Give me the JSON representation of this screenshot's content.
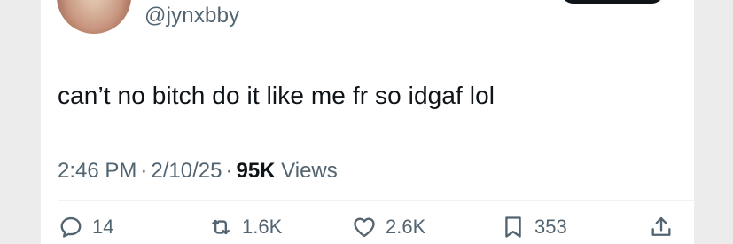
{
  "tweet": {
    "handle": "@jynxbby",
    "text": "can’t no bitch do it like me fr so idgaf lol",
    "time": "2:46 PM",
    "date": "2/10/25",
    "separator": "·",
    "views_count": "95K",
    "views_label": "Views"
  },
  "actions": {
    "replies": "14",
    "reposts": "1.6K",
    "likes": "2.6K",
    "bookmarks": "353"
  },
  "icons": {
    "reply": "speech-bubble-icon",
    "repost": "repost-arrows-icon",
    "like": "heart-icon",
    "bookmark": "bookmark-icon",
    "share": "share-upload-icon"
  },
  "colors": {
    "text_primary": "#0f1419",
    "text_secondary": "#536471",
    "background": "#ffffff"
  }
}
